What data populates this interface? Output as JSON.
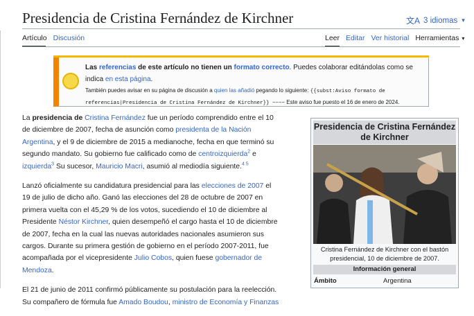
{
  "page": {
    "title": "Presidencia de Cristina Fernández de Kirchner",
    "languages": "3 idiomas"
  },
  "tabs": {
    "left": [
      "Artículo",
      "Discusión"
    ],
    "right": [
      "Leer",
      "Editar",
      "Ver historial",
      "Herramientas"
    ]
  },
  "notice": {
    "line1_a": "Las ",
    "line1_link1": "referencias",
    "line1_b": " de este artículo no tienen un ",
    "line1_link2": "formato correcto",
    "line1_c": ". Puedes colaborar editándolas como se indica ",
    "line1_link3": "en esta página",
    "line1_d": ".",
    "line2_a": "También puedes avisar en su página de discusión a ",
    "line2_link": "quien las añadió",
    "line2_b": " pegando lo siguiente: ",
    "line2_code": "{{subst:Aviso formato de referencias|Presidencia de Cristina Fernández de Kirchner}} ~~~~",
    "line2_c": " Este aviso fue puesto el 16 de enero de 2024."
  },
  "para1": {
    "t1": "La ",
    "t2": "presidencia de ",
    "l1": "Cristina Fernández",
    "t3": " fue un período comprendido entre el 10 de diciembre de 2007, fecha de asunción como ",
    "l2": "presidenta de la Nación Argentina",
    "t4": ", y el 9 de diciembre de 2015 a medianoche, fecha en que terminó su segundo mandato. Su gobierno fue calificado como de ",
    "l3": "centroizquierda",
    "s1": "2",
    "t5": " e ",
    "l4": "izquierda",
    "s2": "3",
    "t6": " Su sucesor, ",
    "l5": "Mauricio Macri",
    "t7": ", asumió al mediodía siguiente.",
    "s3": "4 5"
  },
  "para2": {
    "t1": "Lanzó oficialmente su candidatura presidencial para las ",
    "l1": "elecciones de 2007",
    "t2": " el 19 de julio de dicho año. Ganó las elecciones del 28 de octubre de 2007 en primera vuelta con el 45,29 % de los votos, sucediendo el 10 de diciembre al Presidente ",
    "l2": "Néstor Kirchner",
    "t3": ", quien desempeñó el cargo hasta el 10 de diciembre de 2007, fecha en la cual las nuevas autoridades nacionales asumieron sus cargos. Durante su primera gestión de gobierno en el período 2007-2011, fue acompañada por el vicepresidente ",
    "l3": "Julio Cobos",
    "t4": ", quien fuese ",
    "l4": "gobernador de Mendoza",
    "t5": "."
  },
  "para3": {
    "t1": "El 21 de junio de 2011 confirmó públicamente su postulación para la reelección. Su compañero de fórmula fue ",
    "l1": "Amado Boudou",
    "t2": ", ",
    "l2": "ministro de Economía y Finanzas"
  },
  "infobox": {
    "title": "Presidencia de Cristina Fernández de Kirchner",
    "caption": "Cristina Fernández de Kirchner con el bastón presidencial, 10 de diciembre de 2007.",
    "section": "Información general",
    "row_label": "Ámbito",
    "row_value": "Argentina"
  }
}
